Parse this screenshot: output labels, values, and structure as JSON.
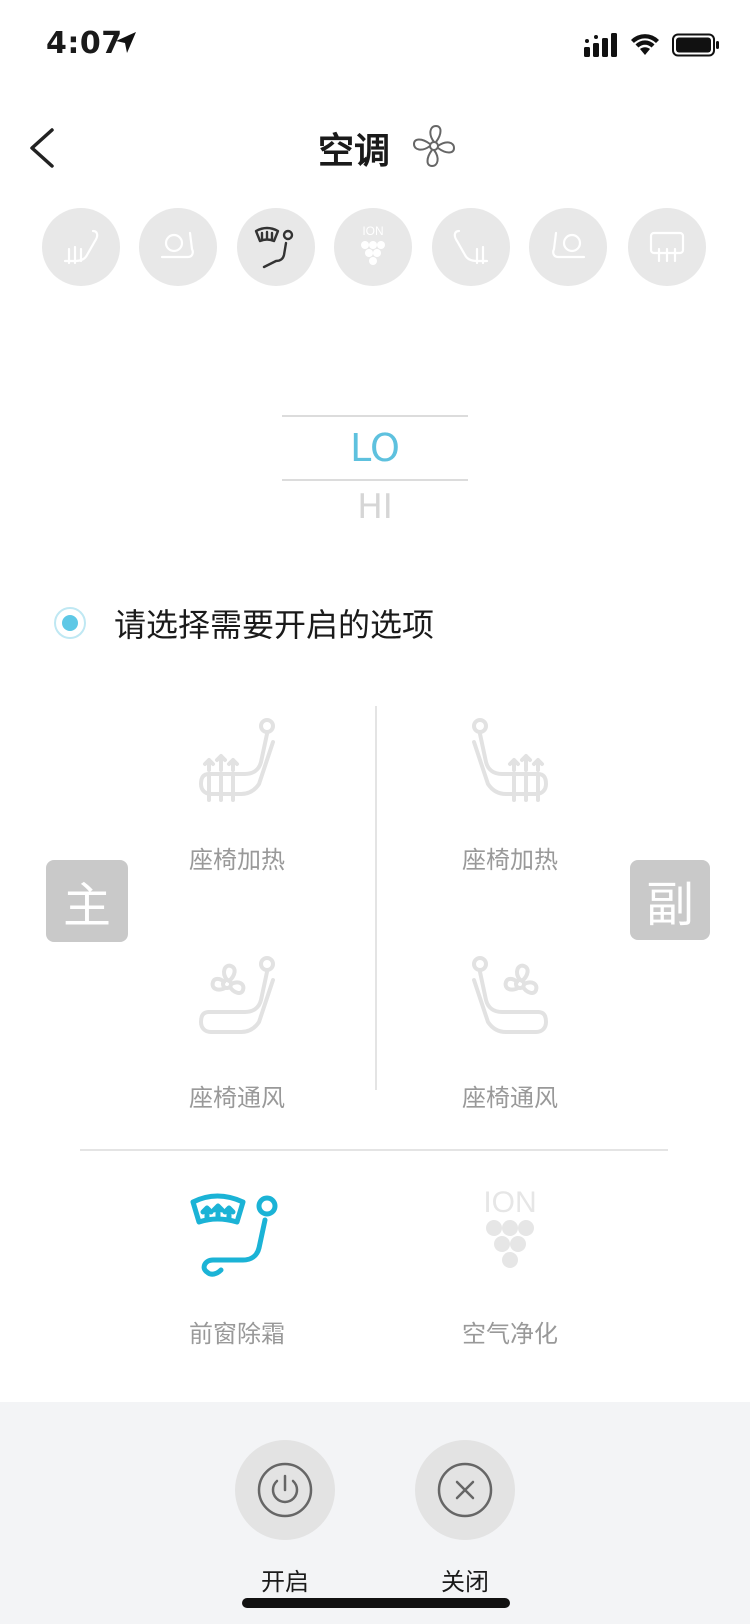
{
  "status_bar": {
    "time": "4:07",
    "icons": [
      "location-arrow-icon",
      "cellular-signal-icon",
      "wifi-icon",
      "battery-icon"
    ]
  },
  "nav": {
    "back_icon": "chevron-left-icon",
    "title": "空调",
    "title_icon": "fan-icon"
  },
  "shortcuts": [
    {
      "name": "seat-heat-icon",
      "active": false
    },
    {
      "name": "seat-ventilation-icon",
      "active": false
    },
    {
      "name": "defrost-icon",
      "active": true
    },
    {
      "name": "ion-purifier-icon",
      "active": false
    },
    {
      "name": "seat-heat-passenger-icon",
      "active": false
    },
    {
      "name": "seat-ventilation-passenger-icon",
      "active": false
    },
    {
      "name": "rear-defrost-icon",
      "active": false
    }
  ],
  "temperature_picker": {
    "selected": "LO",
    "next": "HI"
  },
  "prompt": {
    "text": "请选择需要开启的选项"
  },
  "badges": {
    "driver": "主",
    "passenger": "副"
  },
  "options": {
    "driver_seat_heat": "座椅加热",
    "passenger_seat_heat": "座椅加热",
    "driver_seat_vent": "座椅通风",
    "passenger_seat_vent": "座椅通风",
    "front_defrost": "前窗除霜",
    "air_purify": "空气净化",
    "ion_label": "ION"
  },
  "actions": {
    "on_label": "开启",
    "off_label": "关闭"
  },
  "colors": {
    "accent": "#5ec1de",
    "inactive_icon": "#e2e2e2",
    "badge": "#c9c9c9",
    "bottom_bar": "#f3f4f6"
  }
}
